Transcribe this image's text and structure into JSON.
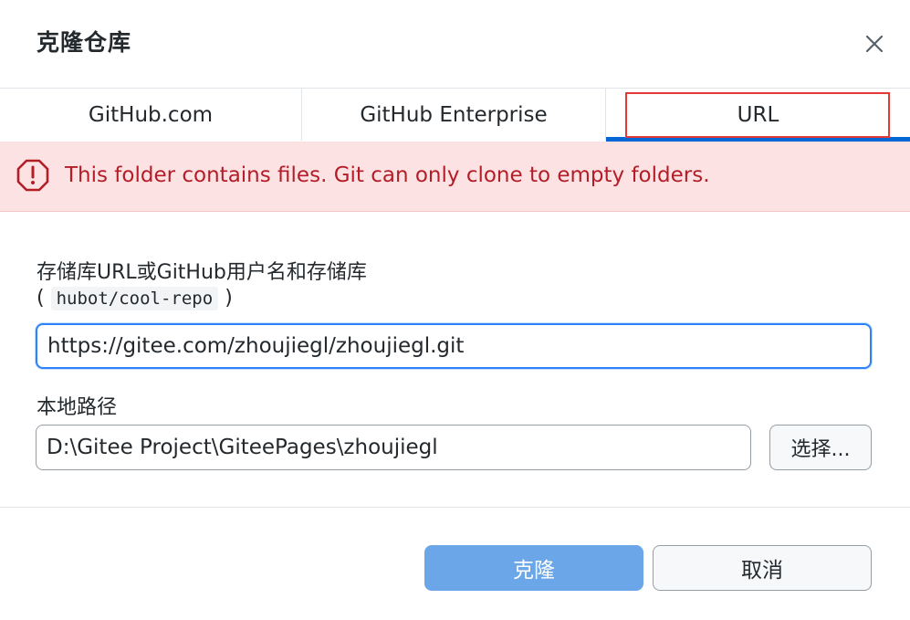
{
  "dialog": {
    "title": "克隆仓库",
    "close_icon": "close-icon"
  },
  "tabs": [
    {
      "label": "GitHub.com",
      "selected": false
    },
    {
      "label": "GitHub Enterprise",
      "selected": false
    },
    {
      "label": "URL",
      "selected": true
    }
  ],
  "error": {
    "icon": "alert-octagon-icon",
    "message": "This folder contains files. Git can only clone to empty folders."
  },
  "form": {
    "url_label": "存储库URL或GitHub用户名和存储库",
    "hint_open": "(",
    "hint_code": "hubot/cool-repo",
    "hint_close": ")",
    "url_value": "https://gitee.com/zhoujiegl/zhoujiegl.git",
    "path_label": "本地路径",
    "path_value": "D:\\Gitee Project\\GiteePages\\zhoujiegl",
    "choose_label": "选择..."
  },
  "footer": {
    "clone_label": "克隆",
    "cancel_label": "取消"
  },
  "colors": {
    "accent": "#0366d6",
    "error_bg": "#fde2e3",
    "error_text": "#b31d28",
    "primary_disabled": "#6aa6e8",
    "annotation_red": "#e53935"
  }
}
